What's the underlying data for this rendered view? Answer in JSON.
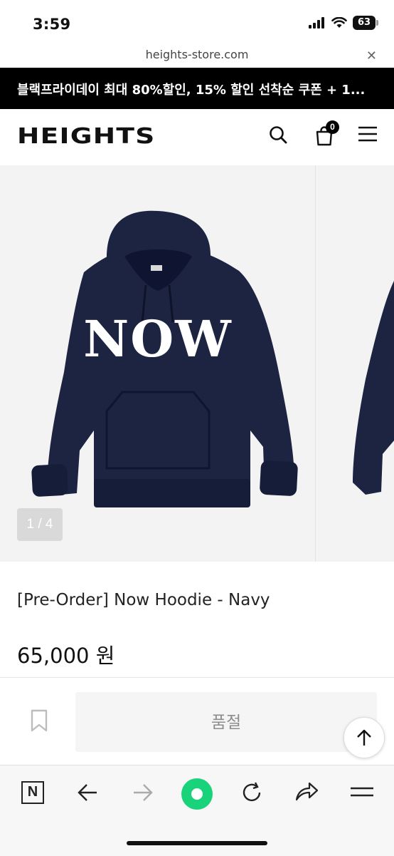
{
  "status_bar": {
    "time": "3:59",
    "battery": "63"
  },
  "browser": {
    "url": "heights-store.com",
    "close_icon": "close-icon"
  },
  "promo": {
    "text": "블랙프라이데이 최대 80%할인, 15% 할인 선착순 쿠폰 + 1..."
  },
  "header": {
    "logo": "HEIGHTS",
    "cart_count": "0",
    "icons": [
      "search-icon",
      "cart-icon",
      "menu-icon"
    ]
  },
  "gallery": {
    "counter": "1 / 4",
    "graphic_text": "NOW",
    "colors": {
      "hoodie": "#1c2442",
      "background": "#f3f3f3"
    }
  },
  "product": {
    "title": "[Pre-Order] Now Hoodie - Navy",
    "price": "65,000 원",
    "soldout_label": "품절"
  },
  "browser_toolbar": {
    "icons": [
      "naver-icon",
      "back-arrow-icon",
      "forward-arrow-icon",
      "green-circle-icon",
      "reload-icon",
      "share-icon",
      "menu-lines-icon"
    ]
  }
}
